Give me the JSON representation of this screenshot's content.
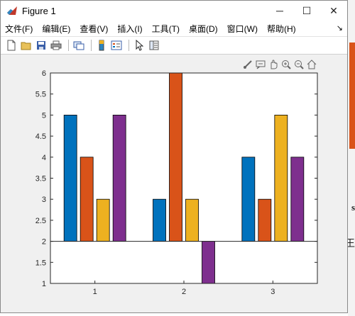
{
  "window": {
    "title": "Figure 1",
    "controls": {
      "minimize": "─",
      "maximize": "☐",
      "close": "✕"
    }
  },
  "menu": [
    "文件(F)",
    "编辑(E)",
    "查看(V)",
    "插入(I)",
    "工具(T)",
    "桌面(D)",
    "窗口(W)",
    "帮助(H)"
  ],
  "menu_overflow": "↘",
  "toolbar": {
    "icons": [
      "new-figure-icon",
      "open-file-icon",
      "save-icon",
      "print-icon",
      "link-plot-icon",
      "colorbar-icon",
      "legend-icon",
      "pointer-icon",
      "property-editor-icon"
    ]
  },
  "axes_toolbar": {
    "icons": [
      "brush-icon",
      "data-tip-icon",
      "pan-icon",
      "zoom-in-icon",
      "zoom-out-icon",
      "home-icon"
    ]
  },
  "background": {
    "text1": "s",
    "text2": "王"
  },
  "colors": {
    "series1": "#0072bd",
    "series2": "#d95319",
    "series3": "#edb120",
    "series4": "#7e2f8e"
  },
  "chart_data": {
    "type": "bar",
    "categories": [
      "1",
      "2",
      "3"
    ],
    "series": [
      {
        "values": [
          5,
          3,
          4
        ]
      },
      {
        "values": [
          4,
          6,
          3
        ]
      },
      {
        "values": [
          3,
          3,
          5
        ]
      },
      {
        "values": [
          5,
          1,
          4
        ]
      }
    ],
    "baseline": 2,
    "ylim": [
      1,
      6
    ],
    "yticks": [
      "1",
      "1.5",
      "2",
      "2.5",
      "3",
      "3.5",
      "4",
      "4.5",
      "5",
      "5.5",
      "6"
    ],
    "grid": false,
    "title": "",
    "xlabel": "",
    "ylabel": ""
  }
}
